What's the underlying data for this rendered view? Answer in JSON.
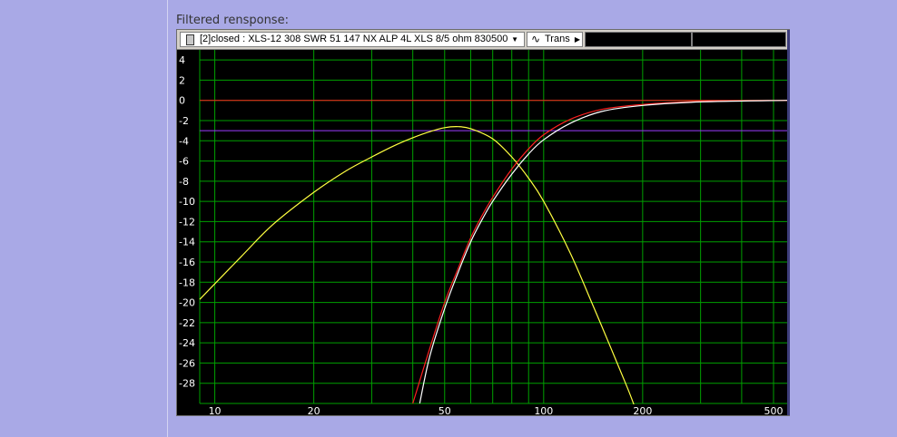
{
  "section": {
    "title": "Filtered rensponse:"
  },
  "toolbar": {
    "driver_label": "[2]closed : XLS-12 308 SWR 51 147 NX ALP 4L XLS 8/5 ohm 830500",
    "transfer_label": "Trans",
    "transfer_icon": "wave-icon",
    "driver_icon": "document-icon"
  },
  "chart_data": {
    "type": "line",
    "title": "",
    "xlabel": "",
    "ylabel": "",
    "xscale": "log",
    "xlim": [
      9,
      550
    ],
    "ylim": [
      -30,
      5
    ],
    "x_ticks": [
      10,
      20,
      50,
      100,
      200,
      500
    ],
    "y_ticks": [
      4,
      2,
      0,
      -2,
      -4,
      -6,
      -8,
      -10,
      -12,
      -14,
      -16,
      -18,
      -20,
      -22,
      -24,
      -26,
      -28
    ],
    "grid": true,
    "colors": {
      "background": "#000000",
      "grid": "#00a000",
      "reference": "#ff2020",
      "marker": "#9b3dff"
    },
    "reference_lines": [
      {
        "y": 0,
        "color": "#ff2020"
      },
      {
        "y": -3,
        "color": "#9b3dff"
      }
    ],
    "series": [
      {
        "color": "#ffff40",
        "x": [
          9,
          12,
          15,
          20,
          25,
          30,
          35,
          40,
          45,
          50,
          55,
          60,
          70,
          80,
          90,
          100,
          120,
          140,
          160,
          180,
          190
        ],
        "y": [
          -19.7,
          -15.5,
          -12.3,
          -9.1,
          -7.0,
          -5.6,
          -4.5,
          -3.7,
          -3.1,
          -2.7,
          -2.6,
          -2.8,
          -3.8,
          -5.6,
          -7.7,
          -10.0,
          -15.0,
          -20.0,
          -24.5,
          -28.5,
          -30.5
        ]
      },
      {
        "color": "#ff2020",
        "x": [
          40,
          45,
          50,
          55,
          60,
          65,
          70,
          80,
          90,
          100,
          120,
          150,
          200,
          300,
          550
        ],
        "y": [
          -30,
          -24.6,
          -20,
          -16.6,
          -13.6,
          -11.4,
          -9.6,
          -6.8,
          -4.8,
          -3.4,
          -1.9,
          -0.9,
          -0.4,
          -0.1,
          0
        ]
      },
      {
        "color": "#ffffff",
        "x": [
          42,
          45,
          50,
          55,
          60,
          65,
          70,
          80,
          90,
          100,
          120,
          150,
          200,
          300,
          550
        ],
        "y": [
          -30,
          -25.4,
          -20.6,
          -17,
          -14,
          -11.8,
          -10,
          -7.3,
          -5.3,
          -3.9,
          -2.3,
          -1.1,
          -0.5,
          -0.15,
          0
        ]
      }
    ]
  }
}
